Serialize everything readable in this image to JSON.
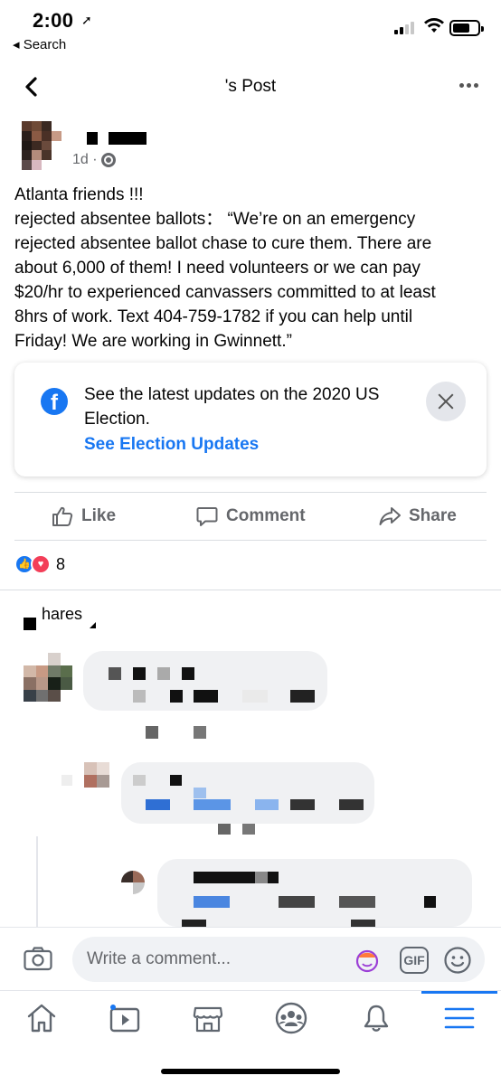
{
  "status_bar": {
    "time": "2:00",
    "location_arrow": "➚",
    "back_app": "◂ Search"
  },
  "nav": {
    "title": "'s Post"
  },
  "post": {
    "timestamp": "1d ·",
    "body_lines": [
      "Atlanta friends !!!",
      "rejected absentee ballots：  “We’re on an emergency",
      "rejected absentee ballot chase to cure them. There are",
      "about 6,000 of them! I need volunteers or we can pay",
      "$20/hr to experienced canvassers committed to at least",
      "8hrs of work. Text 404-759-1782 if you can help until",
      "Friday! We are working in Gwinnett.”"
    ]
  },
  "election_card": {
    "title": "See the latest updates on the 2020 US Election.",
    "link": "See Election Updates",
    "icon": "facebook-icon"
  },
  "actions": {
    "like": "Like",
    "comment": "Comment",
    "share": "Share"
  },
  "reactions": {
    "count": "8"
  },
  "shares": {
    "label": "hares"
  },
  "composer": {
    "placeholder": "Write a comment...",
    "gif_label": "GIF"
  },
  "tabs": [
    "home",
    "watch",
    "marketplace",
    "groups",
    "notifications",
    "menu"
  ],
  "colors": {
    "accent": "#1877f2",
    "secondary_text": "#65676b",
    "love": "#f33e58"
  }
}
